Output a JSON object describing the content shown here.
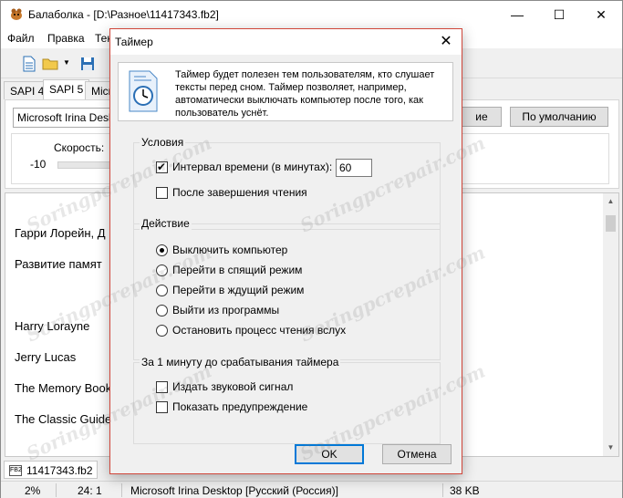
{
  "app": {
    "title": "Балаболка - [D:\\Разное\\11417343.fb2]",
    "window_controls": {
      "minimize": "—",
      "maximize": "☐",
      "close": "✕"
    }
  },
  "menu": {
    "file": "Файл",
    "edit": "Правка",
    "text": "Тек"
  },
  "voice_tabs": [
    "SAPI 4",
    "SAPI 5",
    "Micro"
  ],
  "voice": {
    "selected": "Microsoft Irina Deskto",
    "btn_partial": "ие",
    "btn_default": "По умолчанию",
    "speed_label": "Скорость:",
    "speed_min": "-10"
  },
  "document": {
    "lines": [
      "Гарри Лорейн, Д",
      "Развитие памят",
      "Harry Lorayne",
      "Jerry Lucas",
      "The Memory Book",
      "The Classic Guide"
    ]
  },
  "doc_tabs": [
    "11417343.fb2"
  ],
  "status": {
    "percent": "2%",
    "position": "24: 1",
    "voice": "Microsoft Irina Desktop [Русский (Россия)]",
    "size": "38 KB"
  },
  "dialog": {
    "title": "Таймер",
    "close": "✕",
    "info_text": "Таймер будет полезен тем пользователям, кто слушает тексты перед сном. Таймер позволяет, например, автоматически выключать компьютер после того, как пользователь уснёт.",
    "conditions": {
      "title": "Условия",
      "interval_label": "Интервал времени (в минутах):",
      "interval_checked": true,
      "interval_value": "60",
      "after_reading_label": "После завершения чтения",
      "after_reading_checked": false
    },
    "action": {
      "title": "Действие",
      "options": [
        "Выключить компьютер",
        "Перейти в спящий режим",
        "Перейти в ждущий режим",
        "Выйти из программы",
        "Остановить процесс чтения вслух"
      ],
      "selected_index": 0
    },
    "warning": {
      "title": "За 1 минуту до срабатывания таймера",
      "sound_label": "Издать звуковой сигнал",
      "sound_checked": false,
      "show_warning_label": "Показать предупреждение",
      "show_warning_checked": false
    },
    "ok": "OK",
    "cancel": "Отмена"
  },
  "watermark": "Soringpcrepair.com",
  "colors": {
    "dialog_border": "#d0463a",
    "default_button": "#0078d7"
  },
  "icons": [
    "app-icon",
    "new-document-icon",
    "open-folder-icon",
    "save-icon",
    "timer-clock-icon",
    "fb2-file-icon"
  ]
}
